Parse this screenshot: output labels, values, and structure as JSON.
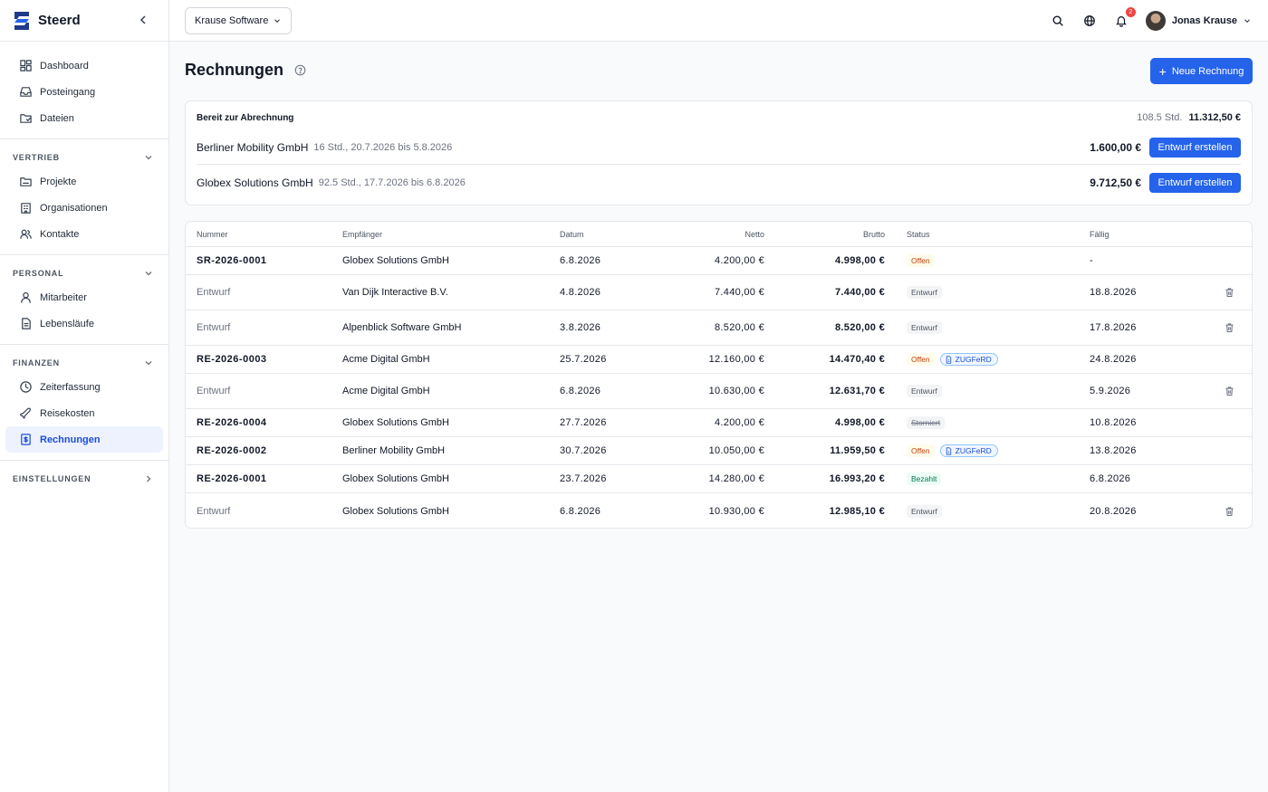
{
  "app": {
    "name": "Steerd"
  },
  "sidebar": {
    "top_items": [
      {
        "label": "Dashboard",
        "icon": "dashboard-icon"
      },
      {
        "label": "Posteingang",
        "icon": "inbox-icon"
      },
      {
        "label": "Dateien",
        "icon": "folder-icon"
      }
    ],
    "sections": [
      {
        "label": "VERTRIEB",
        "items": [
          {
            "label": "Projekte",
            "icon": "projects-icon"
          },
          {
            "label": "Organisationen",
            "icon": "building-icon"
          },
          {
            "label": "Kontakte",
            "icon": "contacts-icon"
          }
        ]
      },
      {
        "label": "PERSONAL",
        "items": [
          {
            "label": "Mitarbeiter",
            "icon": "user-icon"
          },
          {
            "label": "Lebensläufe",
            "icon": "document-icon"
          }
        ]
      },
      {
        "label": "FINANZEN",
        "items": [
          {
            "label": "Zeiterfassung",
            "icon": "clock-icon"
          },
          {
            "label": "Reisekosten",
            "icon": "plane-icon"
          },
          {
            "label": "Rechnungen",
            "icon": "invoice-icon",
            "active": true
          }
        ]
      }
    ],
    "settings_label": "EINSTELLUNGEN"
  },
  "topbar": {
    "org": "Krause Software",
    "notifications_count": "2",
    "user_name": "Jonas Krause"
  },
  "page": {
    "title": "Rechnungen",
    "new_button": "Neue Rechnung"
  },
  "ready": {
    "title": "Bereit zur Abrechnung",
    "total_hours": "108.5 Std.",
    "total_amount": "11.312,50 €",
    "rows": [
      {
        "name": "Berliner Mobility GmbH",
        "meta": "16 Std., 20.7.2026 bis 5.8.2026",
        "amount": "1.600,00 €",
        "button": "Entwurf erstellen"
      },
      {
        "name": "Globex Solutions GmbH",
        "meta": "92.5 Std., 17.7.2026 bis 6.8.2026",
        "amount": "9.712,50 €",
        "button": "Entwurf erstellen"
      }
    ]
  },
  "table": {
    "headers": {
      "number": "Nummer",
      "recipient": "Empfänger",
      "date": "Datum",
      "net": "Netto",
      "gross": "Brutto",
      "status": "Status",
      "due": "Fällig"
    },
    "rows": [
      {
        "number": "SR-2026-0001",
        "draft": false,
        "recipient": "Globex Solutions GmbH",
        "date": "6.8.2026",
        "net": "4.200,00 €",
        "gross": "4.998,00 €",
        "status": "Offen",
        "status_kind": "offen",
        "zugferd": "",
        "due": "-",
        "deletable": false,
        "height": 31
      },
      {
        "number": "Entwurf",
        "draft": true,
        "recipient": "Van Dijk Interactive B.V.",
        "date": "4.8.2026",
        "net": "7.440,00 €",
        "gross": "7.440,00 €",
        "status": "Entwurf",
        "status_kind": "entwurf",
        "zugferd": "",
        "due": "18.8.2026",
        "deletable": true,
        "height": 39
      },
      {
        "number": "Entwurf",
        "draft": true,
        "recipient": "Alpenblick Software GmbH",
        "date": "3.8.2026",
        "net": "8.520,00 €",
        "gross": "8.520,00 €",
        "status": "Entwurf",
        "status_kind": "entwurf",
        "zugferd": "",
        "due": "17.8.2026",
        "deletable": true,
        "height": 39
      },
      {
        "number": "RE-2026-0003",
        "draft": false,
        "recipient": "Acme Digital GmbH",
        "date": "25.7.2026",
        "net": "12.160,00 €",
        "gross": "14.470,40 €",
        "status": "Offen",
        "status_kind": "offen",
        "zugferd": "ZUGFeRD",
        "due": "24.8.2026",
        "deletable": false,
        "height": 31
      },
      {
        "number": "Entwurf",
        "draft": true,
        "recipient": "Acme Digital GmbH",
        "date": "6.8.2026",
        "net": "10.630,00 €",
        "gross": "12.631,70 €",
        "status": "Entwurf",
        "status_kind": "entwurf",
        "zugferd": "",
        "due": "5.9.2026",
        "deletable": true,
        "height": 39
      },
      {
        "number": "RE-2026-0004",
        "draft": false,
        "recipient": "Globex Solutions GmbH",
        "date": "27.7.2026",
        "net": "4.200,00 €",
        "gross": "4.998,00 €",
        "status": "Storniert",
        "status_kind": "storniert",
        "zugferd": "",
        "due": "10.8.2026",
        "deletable": false,
        "height": 31
      },
      {
        "number": "RE-2026-0002",
        "draft": false,
        "recipient": "Berliner Mobility GmbH",
        "date": "30.7.2026",
        "net": "10.050,00 €",
        "gross": "11.959,50 €",
        "status": "Offen",
        "status_kind": "offen",
        "zugferd": "ZUGFeRD",
        "due": "13.8.2026",
        "deletable": false,
        "height": 31
      },
      {
        "number": "RE-2026-0001",
        "draft": false,
        "recipient": "Globex Solutions GmbH",
        "date": "23.7.2026",
        "net": "14.280,00 €",
        "gross": "16.993,20 €",
        "status": "Bezahlt",
        "status_kind": "bezahlt",
        "zugferd": "",
        "due": "6.8.2026",
        "deletable": false,
        "height": 31
      },
      {
        "number": "Entwurf",
        "draft": true,
        "recipient": "Globex Solutions GmbH",
        "date": "6.8.2026",
        "net": "10.930,00 €",
        "gross": "12.985,10 €",
        "status": "Entwurf",
        "status_kind": "entwurf",
        "zugferd": "",
        "due": "20.8.2026",
        "deletable": true,
        "height": 39
      }
    ]
  },
  "colors": {
    "accent": "#2563eb",
    "text": "#111827",
    "muted": "#6b7280",
    "border": "#e5e7eb"
  }
}
